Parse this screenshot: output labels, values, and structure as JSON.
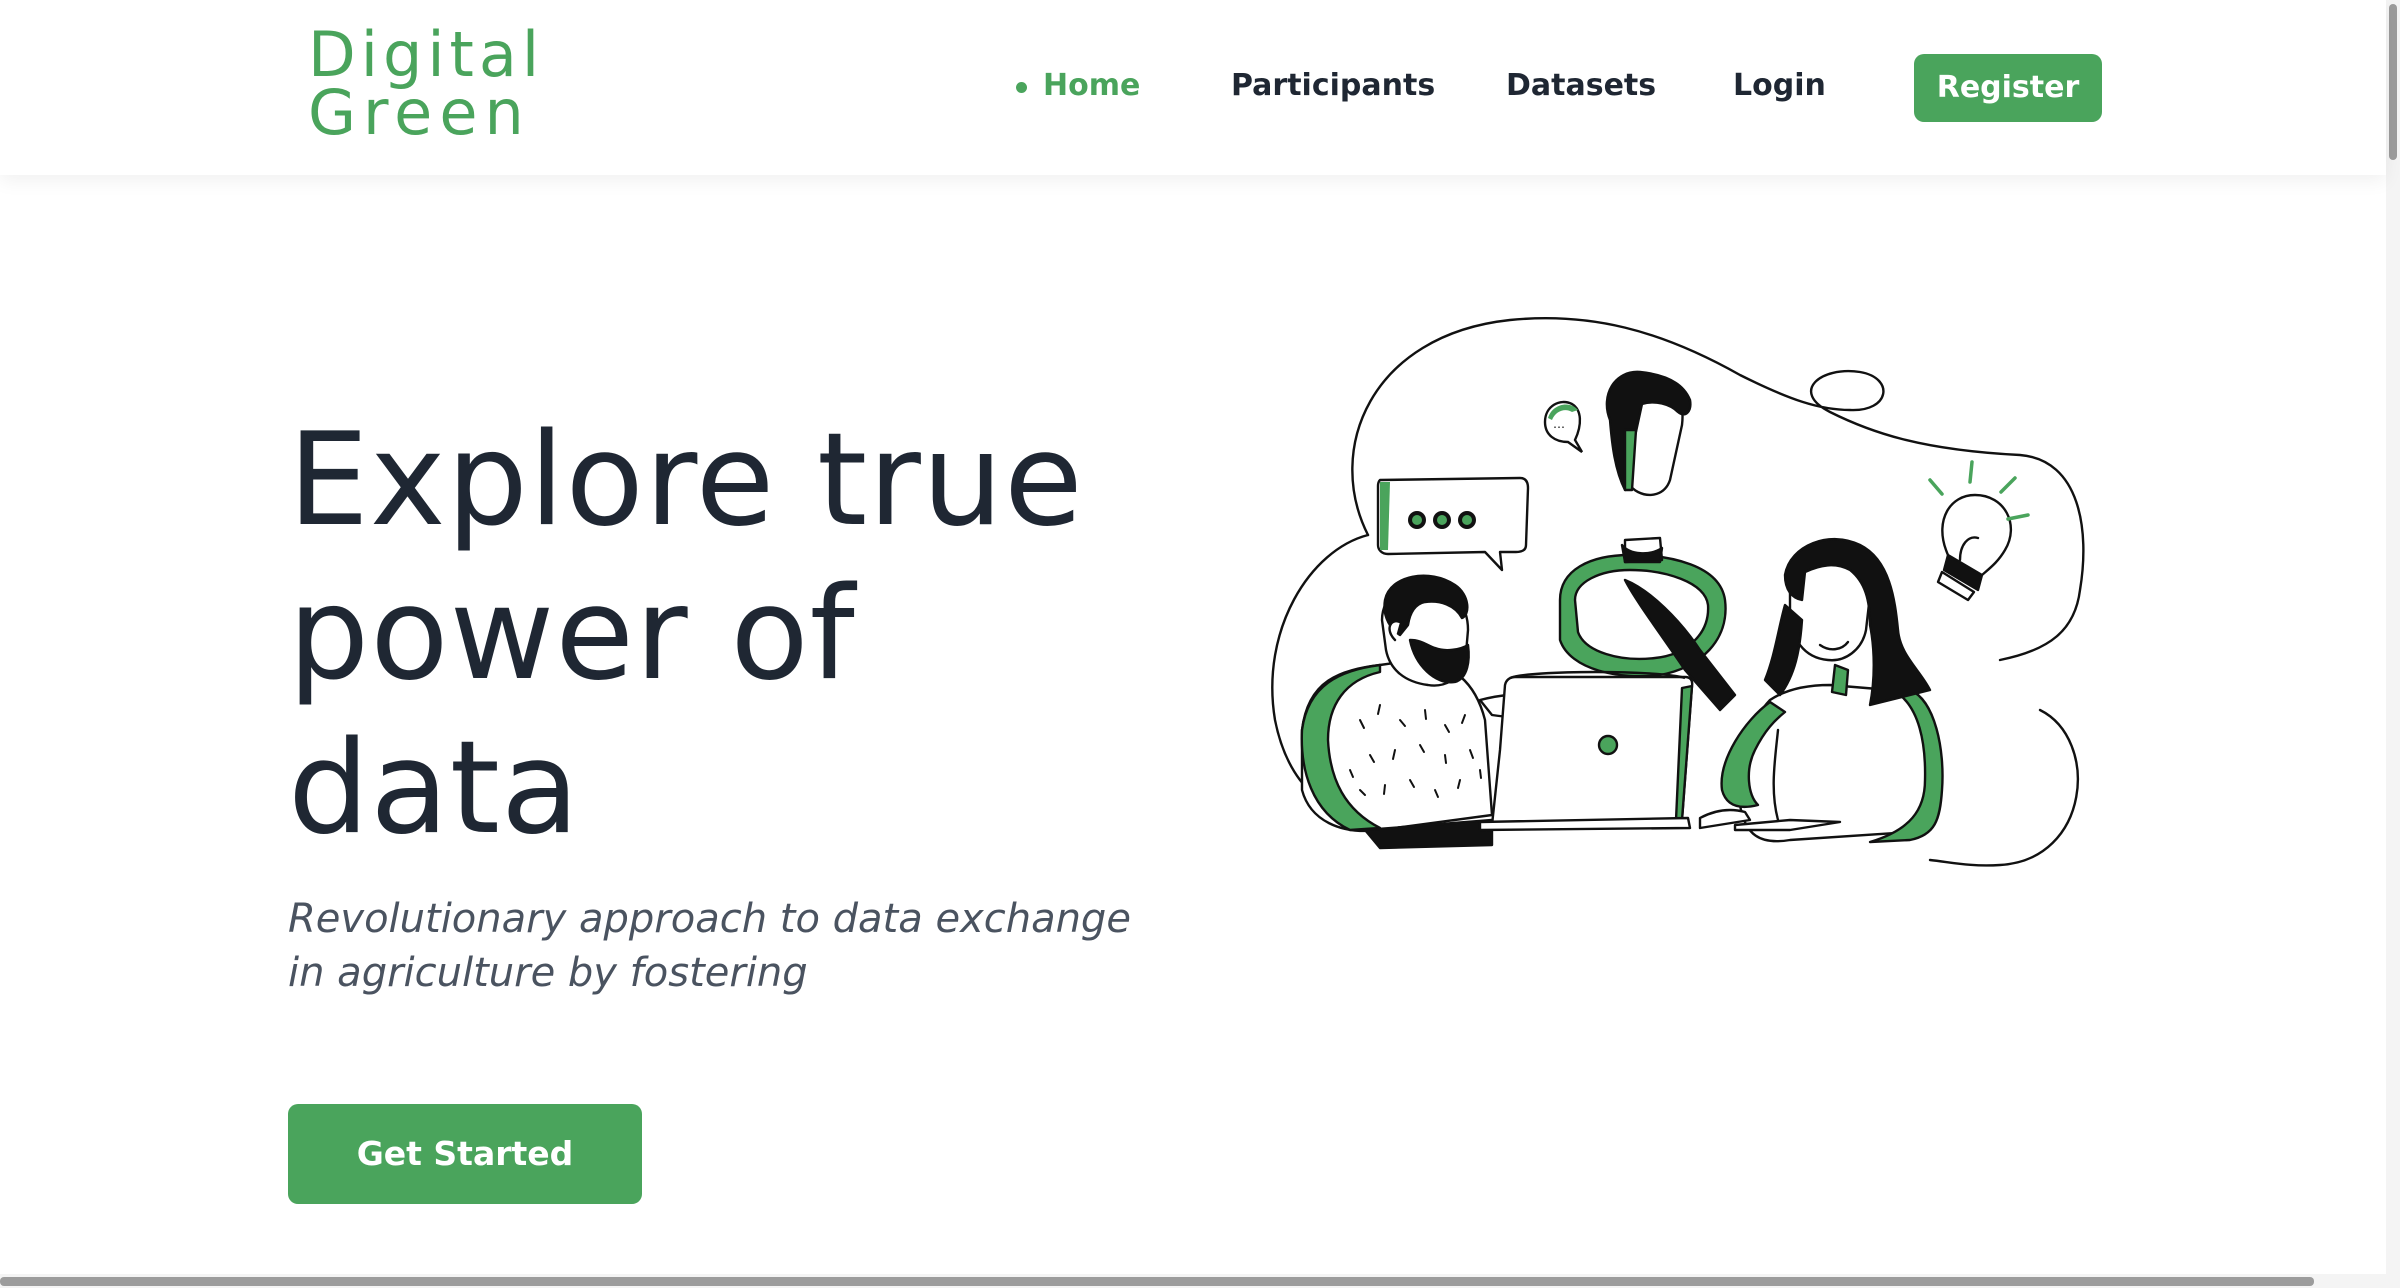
{
  "brand": {
    "logo_line1": "Digital",
    "logo_line2": "Green",
    "color": "#4aa45c"
  },
  "nav": {
    "items": [
      {
        "label": "Home",
        "active": true
      },
      {
        "label": "Participants",
        "active": false
      },
      {
        "label": "Datasets",
        "active": false
      },
      {
        "label": "Login",
        "active": false
      }
    ],
    "register_label": "Register"
  },
  "hero": {
    "title_lines": [
      "Explore true",
      "power of",
      "data"
    ],
    "subtitle_lines": [
      "Revolutionary approach to data exchange",
      "in agriculture by fostering"
    ],
    "cta_label": "Get Started"
  },
  "colors": {
    "accent": "#4aa45c",
    "text": "#1f2733",
    "muted": "#4a5360"
  }
}
